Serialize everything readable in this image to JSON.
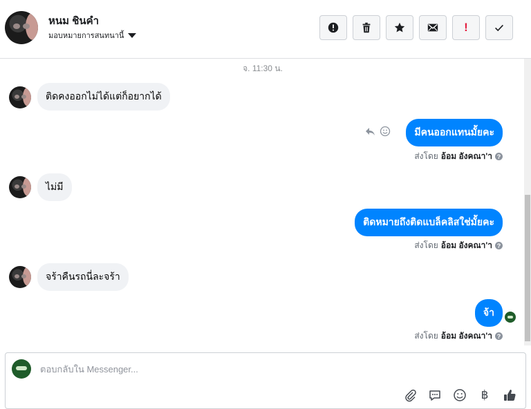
{
  "header": {
    "contact_name": "หนม ชินคำ",
    "assign_label": "มอบหมายการสนทนานี้",
    "tools": [
      {
        "name": "report-button",
        "icon": "alert-circle-icon"
      },
      {
        "name": "delete-button",
        "icon": "trash-icon"
      },
      {
        "name": "star-button",
        "icon": "star-icon"
      },
      {
        "name": "mark-unread-button",
        "icon": "envelope-icon"
      },
      {
        "name": "follow-up-button",
        "icon": "exclamation-icon"
      },
      {
        "name": "done-button",
        "icon": "check-icon"
      }
    ]
  },
  "thread": {
    "timestamp": "จ. 11:30 น.",
    "messages": [
      {
        "direction": "in",
        "text": "ติดคงออกไม่ได้แต่ก็อยากได้"
      },
      {
        "direction": "out",
        "text": "มีคนออกแทนมั้ยคะ",
        "sent_prefix": "ส่งโดย",
        "sent_by": "อ้อม อังคณา'า"
      },
      {
        "direction": "in",
        "text": "ไม่มี"
      },
      {
        "direction": "out",
        "text": "ติดหมายถึงติดแบล็คลิสใช่มั้ยคะ",
        "sent_prefix": "ส่งโดย",
        "sent_by": "อ้อม อังคณา'า"
      },
      {
        "direction": "in",
        "text": "จร้าคืนรถนี่ละจร้า"
      },
      {
        "direction": "out",
        "text": "จ้า",
        "sent_prefix": "ส่งโดย",
        "sent_by": "อ้อม อังคณา'า"
      }
    ]
  },
  "composer": {
    "placeholder": "ตอบกลับใน Messenger...",
    "currency_symbol": "฿"
  },
  "colors": {
    "outgoing_bubble": "#0084ff",
    "incoming_bubble": "#f0f2f5",
    "alert_red": "#e41e3f"
  }
}
